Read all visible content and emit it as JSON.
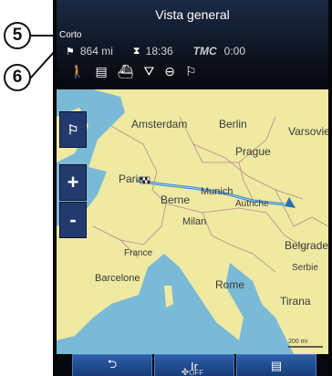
{
  "callouts": {
    "first": "5",
    "second": "6"
  },
  "header": {
    "title": "Vista general"
  },
  "route": {
    "type_label": "Corto",
    "distance": "864 mi",
    "arrival_time": "18:36",
    "tmc_label": "TMC",
    "traffic_delay": "0:00"
  },
  "map": {
    "cities": {
      "amsterdam": "Amsterdam",
      "berlin": "Berlin",
      "varsovie": "Varsovie",
      "prague": "Prague",
      "paris": "Paris",
      "munich": "Munich",
      "berne": "Berne",
      "autriche": "Autriche",
      "milan": "Milan",
      "belgrade": "Belgrade",
      "france": "France",
      "serbie": "Serbie",
      "barcelone": "Barcelone",
      "rome": "Rome",
      "tirana": "Tirana"
    },
    "zoom_in": "+",
    "zoom_out": "-",
    "scale": "200 mi"
  },
  "toolbar": {
    "back_icon": "back-arrow-icon",
    "go_label": "Ir",
    "menu_icon": "list-menu-icon"
  },
  "climate": {
    "fan_status": "OFF"
  },
  "colors": {
    "accent_blue": "#1e4c96",
    "route": "#3a86c8",
    "land": "#efe9a2",
    "sea": "#7bbad6"
  }
}
